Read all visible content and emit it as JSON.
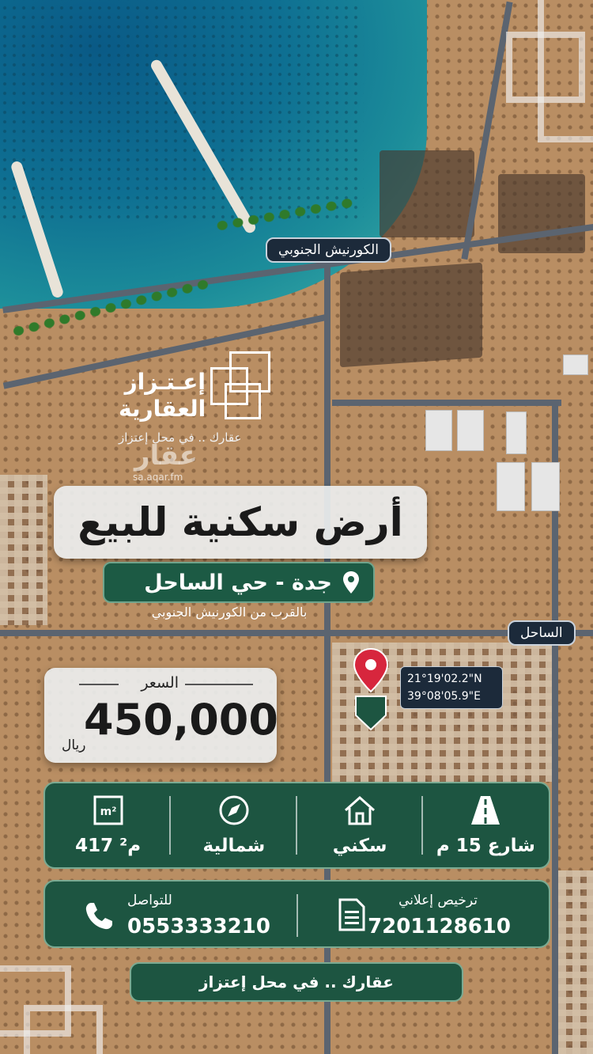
{
  "streets": {
    "corniche": "الكورنيش الجنوبي",
    "sahel": "الساحل"
  },
  "logo": {
    "name_line1": "إعـتـزاز",
    "name_line2": "العقارية",
    "tagline": "عقارك .. في محل إعتزاز"
  },
  "watermark": {
    "brand": "عقار",
    "url": "sa.aqar.fm"
  },
  "title": "أرض سكنية للبيع",
  "location": {
    "label": "جدة - حي الساحل",
    "note": "بالقرب من الكورنيش الجنوبي",
    "icon": "map-pin-icon"
  },
  "coordinates": {
    "lat": "21°19'02.2\"N",
    "lng": "39°08'05.9\"E"
  },
  "price": {
    "label": "السعر",
    "value": "450,000",
    "currency": "ريال"
  },
  "features": [
    {
      "icon": "road-icon",
      "value": "شارع 15 م"
    },
    {
      "icon": "house-icon",
      "value": "سكني"
    },
    {
      "icon": "compass-icon",
      "value": "شمالية"
    },
    {
      "icon": "area-m2-icon",
      "value": "417 م²"
    }
  ],
  "contact": {
    "license_label": "ترخيص إعلاني",
    "license_value": "7201128610",
    "phone_label": "للتواصل",
    "phone_value": "0553333210"
  },
  "slogan": "عقارك .. في محل إعتزاز",
  "colors": {
    "brand_green": "#1d5541",
    "pin_red": "#d7263d",
    "chip_dark": "#1c2a3a"
  }
}
